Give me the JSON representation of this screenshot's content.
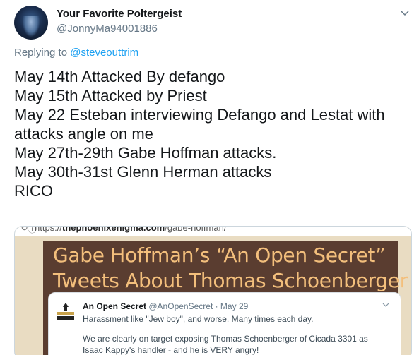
{
  "tweet": {
    "display_name": "Your Favorite Poltergeist",
    "handle": "@JonnyMa94001886",
    "replying_prefix": "Replying to ",
    "replying_to": "@steveouttrim",
    "lines": [
      "May 14th Attacked By defango",
      "May 15th Attacked by Priest",
      "May 22 Esteban interviewing Defango and Lestat with",
      "attacks angle on me",
      "May 27th-29th Gabe Hoffman attacks.",
      "May 30th-31st Glenn Herman attacks",
      "RICO"
    ]
  },
  "card": {
    "url_prefix": "https://",
    "url_domain": "thephoenixenigma.com",
    "url_path": "/gabe-hoffman/",
    "slide_title_line1": "Gabe Hoffman’s “An Open Secret”",
    "slide_title_line2": "Tweets About Thomas Schoenberger",
    "embed": {
      "name": "An Open Secret",
      "handle_date": "@AnOpenSecret · May 29",
      "line1": "Harassment like \"Jew boy\", and worse. Many times each day.",
      "line2": "We are clearly on target exposing Thomas Schoenberger of Cicada 3301 as",
      "line3": "Isaac Kappy's handler - and he is VERY angry!"
    }
  },
  "colors": {
    "link": "#1da1f2",
    "secondary_text": "#657786",
    "slide_bg": "#5a3d30",
    "slide_text": "#f3bf7c",
    "card_bg": "#e9dcc2"
  },
  "icons": [
    "avatar-image",
    "chevron-down-icon",
    "reload-icon",
    "info-icon",
    "open-secret-logo"
  ]
}
